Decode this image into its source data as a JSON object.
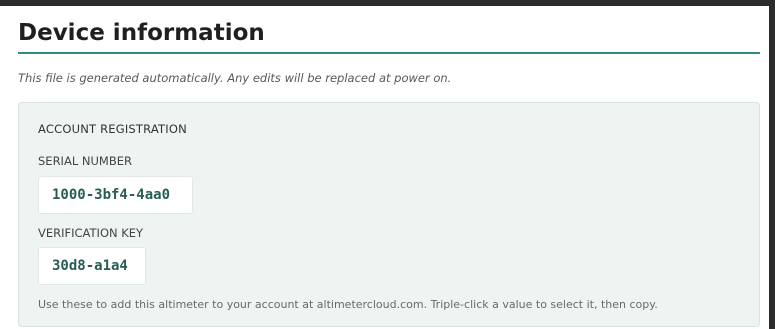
{
  "page": {
    "title": "Device information",
    "notice": "This file is generated automatically. Any edits will be replaced at power on."
  },
  "registration": {
    "heading": "ACCOUNT REGISTRATION",
    "serial_label": "SERIAL NUMBER",
    "serial_value": "1000-3bf4-4aa0",
    "key_label": "VERIFICATION KEY",
    "key_value": "30d8-a1a4",
    "helper": "Use these to add this altimeter to your account at altimetercloud.com. Triple-click a value to select it, then copy."
  },
  "colors": {
    "accent": "#2f8f85",
    "panel_background": "#eef4f2",
    "value_text": "#285d56"
  }
}
